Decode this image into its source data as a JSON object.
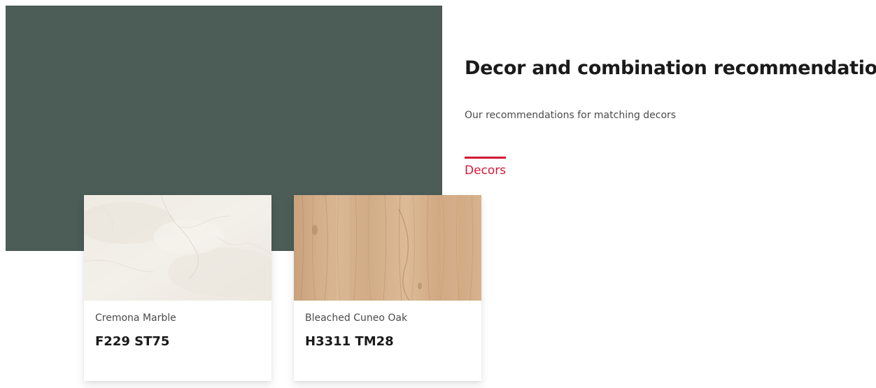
{
  "hero": {
    "swatch_color": "#4c5c57"
  },
  "section": {
    "title": "Decor and combination recommendations",
    "subtitle": "Our recommendations for matching decors",
    "active_tab": "Decors",
    "accent_color": "#d31837"
  },
  "cards": [
    {
      "name": "Cremona Marble",
      "code": "F229 ST75",
      "texture": "marble-texture"
    },
    {
      "name": "Bleached Cuneo Oak",
      "code": "H3311 TM28",
      "texture": "oak-wood-texture"
    }
  ]
}
